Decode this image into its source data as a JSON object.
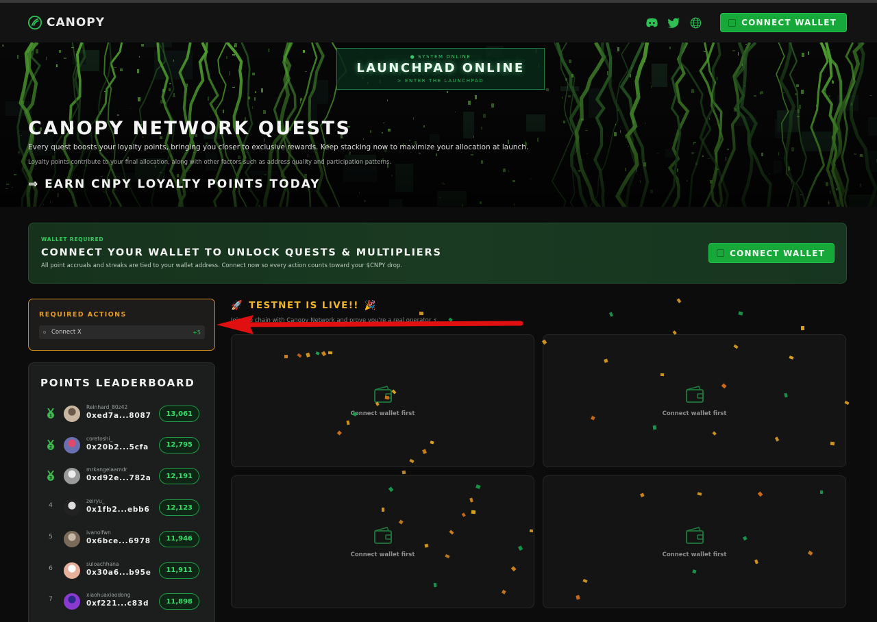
{
  "header": {
    "brand": "CANOPY",
    "icons": [
      "discord-icon",
      "twitter-icon",
      "globe-icon"
    ],
    "connect_label": "CONNECT WALLET"
  },
  "hero": {
    "launch_status": "● SYSTEM ONLINE",
    "launch_title": "LAUNCHPAD ONLINE",
    "launch_sub": "> ENTER THE LAUNCHPAD",
    "title": "CANOPY NETWORK QUESTS",
    "paragraph": "Every quest boosts your loyalty points, bringing you closer to exclusive rewards. Keep stacking now to maximize your allocation at launch.",
    "note": "Loyalty points contribute to your final allocation, along with other factors such as address quality and participation patterns.",
    "cta": "⇒ EARN CNPY LOYALTY POINTS TODAY"
  },
  "banner": {
    "tag": "WALLET REQUIRED",
    "title": "CONNECT YOUR WALLET TO UNLOCK QUESTS & MULTIPLIERS",
    "subtitle": "All point accruals and streaks are tied to your wallet address. Connect now so every action counts toward your $CNPY drop.",
    "button": "CONNECT WALLET"
  },
  "required": {
    "title": "REQUIRED ACTIONS",
    "items": [
      {
        "label": "Connect X",
        "points": "+5"
      }
    ]
  },
  "leaderboard": {
    "title": "POINTS LEADERBOARD",
    "rows": [
      {
        "rank": "1",
        "user": "Reinhard_80z42",
        "address": "0xed7a...8087",
        "score": "13,061"
      },
      {
        "rank": "2",
        "user": "coretoshi_",
        "address": "0x20b2...5cfa",
        "score": "12,795"
      },
      {
        "rank": "3",
        "user": "mrkangelaamdr",
        "address": "0xd92e...782a",
        "score": "12,191"
      },
      {
        "rank": "4",
        "user": "zeiryu_",
        "address": "0x1fb2...ebb6",
        "score": "12,123"
      },
      {
        "rank": "5",
        "user": "ivanolfwn",
        "address": "0x6bce...6978",
        "score": "11,946"
      },
      {
        "rank": "6",
        "user": "suloachhana",
        "address": "0x30a6...b95e",
        "score": "11,911"
      },
      {
        "rank": "7",
        "user": "xiaohuaxiaodong",
        "address": "0xf221...c83d",
        "score": "11,898"
      }
    ]
  },
  "testnet": {
    "emoji_left": "🚀",
    "title": "TESTNET IS LIVE!!",
    "emoji_right": "🎉",
    "subtitle": "Join the chain with Canopy Network and prove you're a real operator ⚡"
  },
  "quests": [
    {
      "label": "Connect wallet first"
    },
    {
      "label": "Connect wallet first"
    },
    {
      "label": "Connect wallet first"
    },
    {
      "label": "Connect wallet first"
    }
  ],
  "colors": {
    "accent_green": "#17a83a",
    "required_orange": "#e59a22",
    "testnet_gold": "#f0b52a",
    "arrow_red": "#e01010"
  }
}
